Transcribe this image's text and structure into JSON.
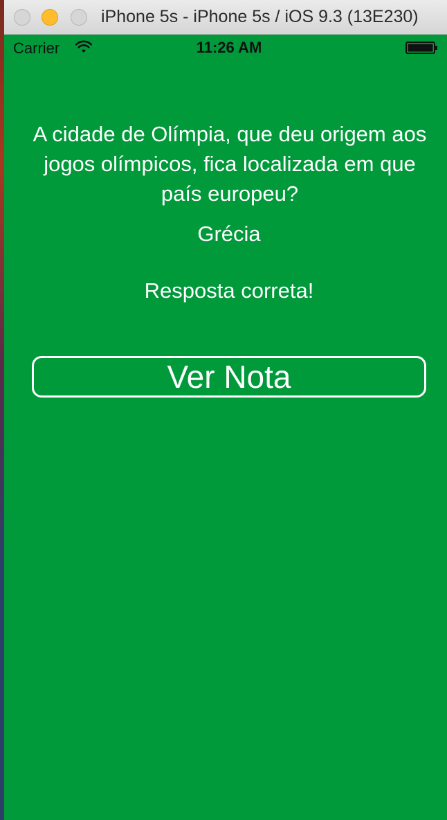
{
  "window": {
    "title": "iPhone 5s - iPhone 5s / iOS 9.3 (13E230)"
  },
  "status_bar": {
    "carrier": "Carrier",
    "time": "11:26 AM",
    "wifi_icon": "wifi-icon",
    "battery_icon": "battery-icon"
  },
  "quiz": {
    "question": "A cidade de Olímpia, que deu origem aos jogos olímpicos, fica localizada em que país europeu?",
    "answer": "Grécia",
    "result": "Resposta correta!",
    "button_label": "Ver Nota"
  },
  "colors": {
    "background": "#009a3b",
    "text": "#ffffff",
    "minimize_button": "#ffbd2e"
  }
}
